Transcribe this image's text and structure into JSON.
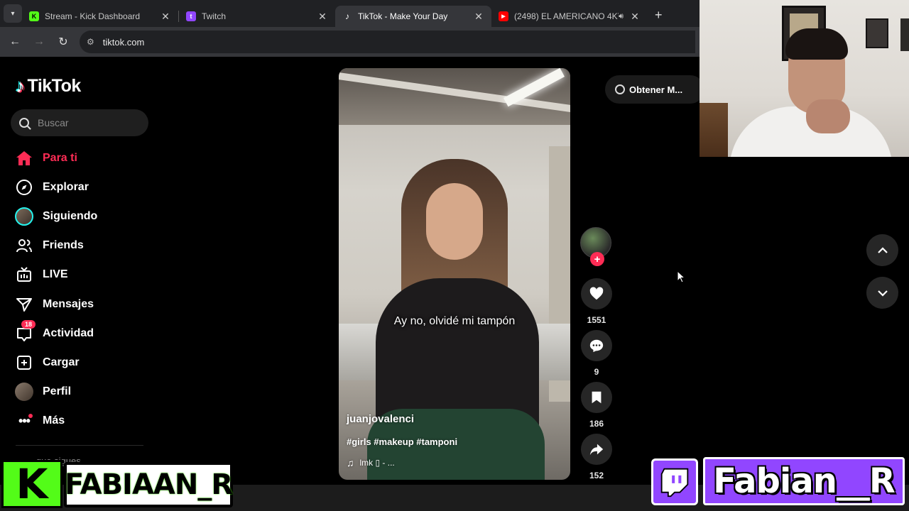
{
  "browser": {
    "tabs": [
      {
        "title": "Stream - Kick Dashboard",
        "favicon": "kick-icon",
        "color": "#53fc18",
        "active": false
      },
      {
        "title": "Twitch",
        "favicon": "twitch-icon",
        "color": "#9146ff",
        "active": false
      },
      {
        "title": "TikTok - Make Your Day",
        "favicon": "tiktok-icon",
        "color": "#ffffff",
        "active": true
      },
      {
        "title": "(2498) EL AMERICANO 4KT",
        "favicon": "youtube-icon",
        "color": "#ff0000",
        "active": false,
        "audio": true
      }
    ],
    "url": "tiktok.com"
  },
  "tiktok": {
    "logo_text": "TikTok",
    "search": {
      "placeholder": "Buscar",
      "value": ""
    },
    "nav": [
      {
        "label": "Para ti",
        "icon": "home-icon",
        "active": true
      },
      {
        "label": "Explorar",
        "icon": "compass-icon"
      },
      {
        "label": "Siguiendo",
        "icon": "following-avatar-icon"
      },
      {
        "label": "Friends",
        "icon": "friends-icon"
      },
      {
        "label": "LIVE",
        "icon": "live-tv-icon"
      },
      {
        "label": "Mensajes",
        "icon": "send-icon"
      },
      {
        "label": "Actividad",
        "icon": "activity-icon",
        "badge": "18"
      },
      {
        "label": "Cargar",
        "icon": "upload-icon"
      },
      {
        "label": "Perfil",
        "icon": "profile-avatar-icon"
      },
      {
        "label": "Más",
        "icon": "more-icon"
      }
    ],
    "following_section_partial": "...que sigues",
    "get_app_label": "Obtener M...",
    "video": {
      "caption_overlay": "Ay no, olvidé mi tampón",
      "author": "juanjovalenci",
      "hashtags": "#girls #makeup #tamponi",
      "music": "lmk ▯ - ..."
    },
    "actions": {
      "likes": "1551",
      "comments": "9",
      "saves": "186",
      "shares": "152"
    }
  },
  "overlay": {
    "kick_name": "FABIAAN_R",
    "twitch_name": "Fabian__R",
    "kick_color": "#53fc18",
    "twitch_color": "#9146ff",
    "accent": "#fe2c55"
  }
}
